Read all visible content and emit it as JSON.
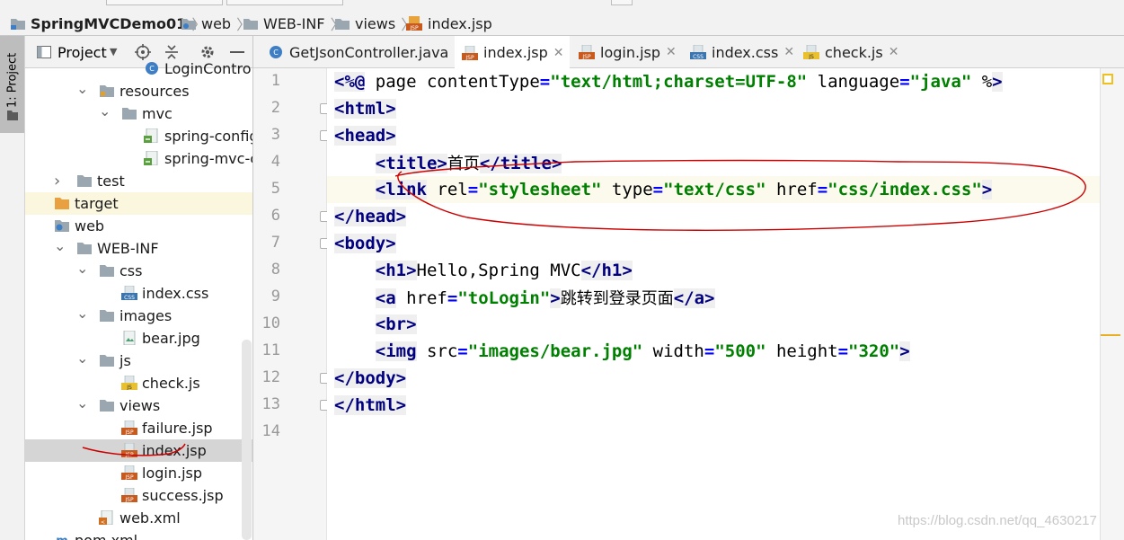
{
  "breadcrumb": {
    "items": [
      "SpringMVCDemo01",
      "web",
      "WEB-INF",
      "views",
      "index.jsp"
    ]
  },
  "left_stripe": {
    "label": "1: Project"
  },
  "project_panel": {
    "title": "Project",
    "tree": [
      {
        "label": "LoginContro",
        "icon": "java-class-icon",
        "partial": true
      },
      {
        "label": "resources",
        "icon": "folder-resources-icon",
        "expanded": true
      },
      {
        "label": "mvc",
        "icon": "folder-icon",
        "expanded": true
      },
      {
        "label": "spring-config.xm",
        "icon": "spring-xml-icon"
      },
      {
        "label": "spring-mvc-conf",
        "icon": "spring-xml-icon"
      },
      {
        "label": "test",
        "icon": "folder-icon",
        "expanded": false
      },
      {
        "label": "target",
        "icon": "folder-orange-icon",
        "highlighted": true
      },
      {
        "label": "web",
        "icon": "web-folder-icon"
      },
      {
        "label": "WEB-INF",
        "icon": "folder-icon",
        "expanded": true
      },
      {
        "label": "css",
        "icon": "folder-icon",
        "expanded": true
      },
      {
        "label": "index.css",
        "icon": "css-file-icon"
      },
      {
        "label": "images",
        "icon": "folder-icon",
        "expanded": true
      },
      {
        "label": "bear.jpg",
        "icon": "image-file-icon"
      },
      {
        "label": "js",
        "icon": "folder-icon",
        "expanded": true
      },
      {
        "label": "check.js",
        "icon": "js-file-icon"
      },
      {
        "label": "views",
        "icon": "folder-icon",
        "expanded": true
      },
      {
        "label": "failure.jsp",
        "icon": "jsp-file-icon"
      },
      {
        "label": "index.jsp",
        "icon": "jsp-file-icon",
        "selected": true
      },
      {
        "label": "login.jsp",
        "icon": "jsp-file-icon"
      },
      {
        "label": "success.jsp",
        "icon": "jsp-file-icon"
      },
      {
        "label": "web.xml",
        "icon": "xml-file-icon"
      },
      {
        "label": "pom.xml",
        "icon": "maven-icon",
        "partial": true
      }
    ]
  },
  "editor_tabs": [
    {
      "label": "GetJsonController.java",
      "icon": "java-class-icon",
      "active": false
    },
    {
      "label": "index.jsp",
      "icon": "jsp-file-icon",
      "active": true
    },
    {
      "label": "login.jsp",
      "icon": "jsp-file-icon",
      "active": false
    },
    {
      "label": "index.css",
      "icon": "css-file-icon",
      "active": false
    },
    {
      "label": "check.js",
      "icon": "js-file-icon",
      "active": false
    }
  ],
  "code": {
    "line_numbers": [
      "1",
      "2",
      "3",
      "4",
      "5",
      "6",
      "7",
      "8",
      "9",
      "10",
      "11",
      "12",
      "13",
      "14"
    ],
    "lines": [
      "<%@ page contentType=\"text/html;charset=UTF-8\" language=\"java\" %>",
      "<html>",
      "<head>",
      "    <title>首页</title>",
      "    <link rel=\"stylesheet\" type=\"text/css\" href=\"css/index.css\">",
      "</head>",
      "<body>",
      "    <h1>Hello,Spring MVC</h1>",
      "    <a href=\"toLogin\">跳转到登录页面</a>",
      "    <br>",
      "    <img src=\"images/bear.jpg\" width=\"500\" height=\"320\">",
      "</body>",
      "</html>",
      ""
    ]
  },
  "watermark": "https://blog.csdn.net/qq_4630217",
  "colors": {
    "tag": "#000080",
    "attribute": "#0000ff",
    "string": "#008000",
    "annotation_red": "#cc0000"
  }
}
